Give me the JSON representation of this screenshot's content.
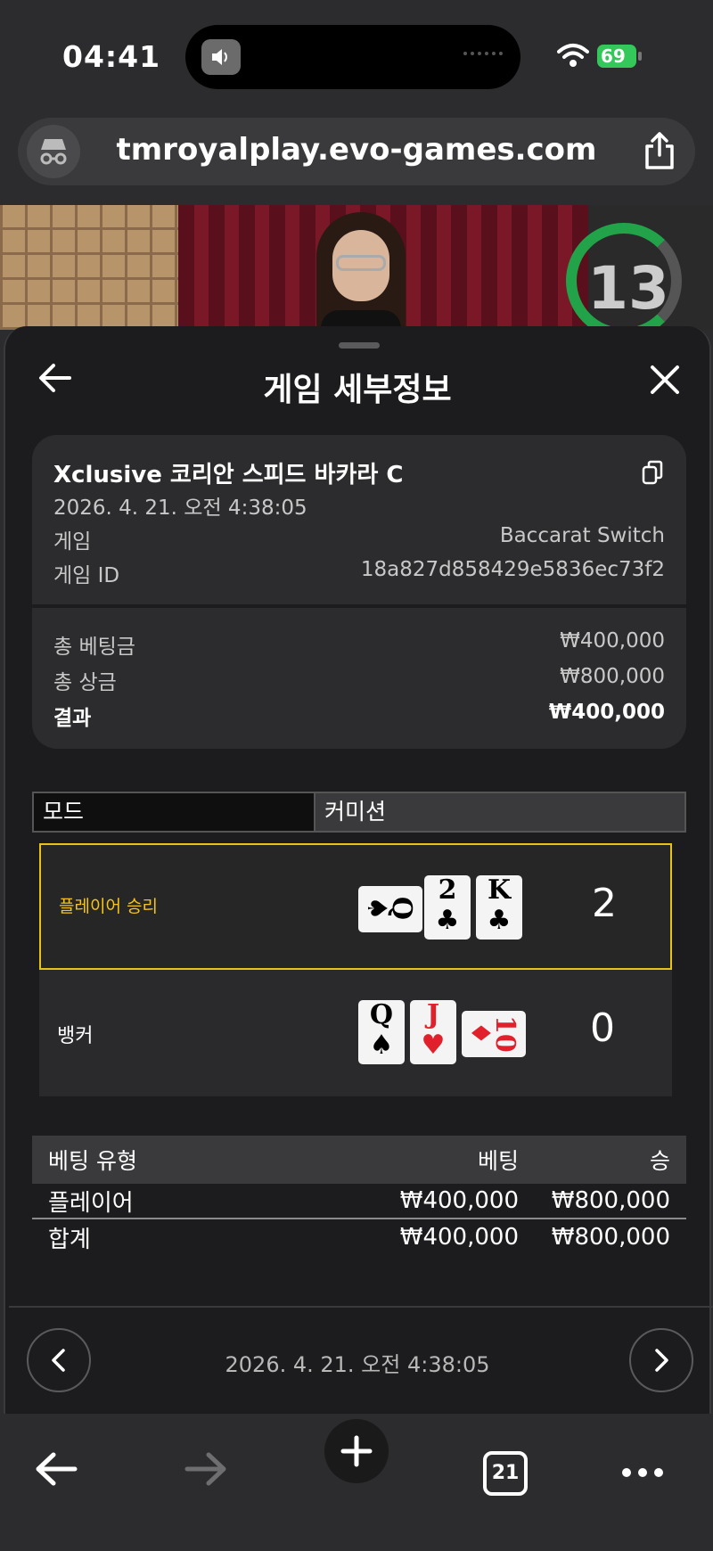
{
  "status_bar": {
    "time": "04:41",
    "battery": "69"
  },
  "browser": {
    "url": "tmroyalplay.evo-games.com",
    "tab_count": "21"
  },
  "video": {
    "timer": "13"
  },
  "sheet": {
    "title": "게임 세부정보",
    "table_name": "Xclusive 코리안 스피드 바카라 C",
    "datetime": "2026. 4. 21. 오전 4:38:05",
    "game_label": "게임",
    "game_value": "Baccarat Switch",
    "game_id_label": "게임 ID",
    "game_id_value": "18a827d858429e5836ec73f2",
    "total_bet_label": "총 베팅금",
    "total_bet_value": "₩400,000",
    "total_prize_label": "총 상금",
    "total_prize_value": "₩800,000",
    "result_label": "결과",
    "result_value": "₩400,000"
  },
  "tabs": {
    "mode": "모드",
    "commission": "커미션"
  },
  "outcomes": {
    "player": {
      "label": "플레이어 승리",
      "score": "2",
      "cards": [
        {
          "rank": "Q",
          "suit": "♠",
          "color": "#000000"
        },
        {
          "rank": "2",
          "suit": "♣",
          "color": "#000000"
        },
        {
          "rank": "K",
          "suit": "♣",
          "color": "#000000"
        }
      ]
    },
    "banker": {
      "label": "뱅커",
      "score": "0",
      "cards": [
        {
          "rank": "Q",
          "suit": "♠",
          "color": "#000000"
        },
        {
          "rank": "J",
          "suit": "♥",
          "color": "#e0212b"
        },
        {
          "rank": "10",
          "suit": "♦",
          "color": "#e0212b"
        }
      ]
    }
  },
  "bets_table": {
    "headers": [
      "베팅 유형",
      "베팅",
      "승"
    ],
    "rows": [
      [
        "플레이어",
        "₩400,000",
        "₩800,000"
      ]
    ],
    "total": [
      "합계",
      "₩400,000",
      "₩800,000"
    ]
  },
  "footer": {
    "datetime": "2026. 4. 21. 오전 4:38:05"
  },
  "colors": {
    "winner_border": "#e8c317",
    "winner_label": "#f5c518",
    "battery": "#34c759",
    "timer_ring": "#22a34a"
  }
}
